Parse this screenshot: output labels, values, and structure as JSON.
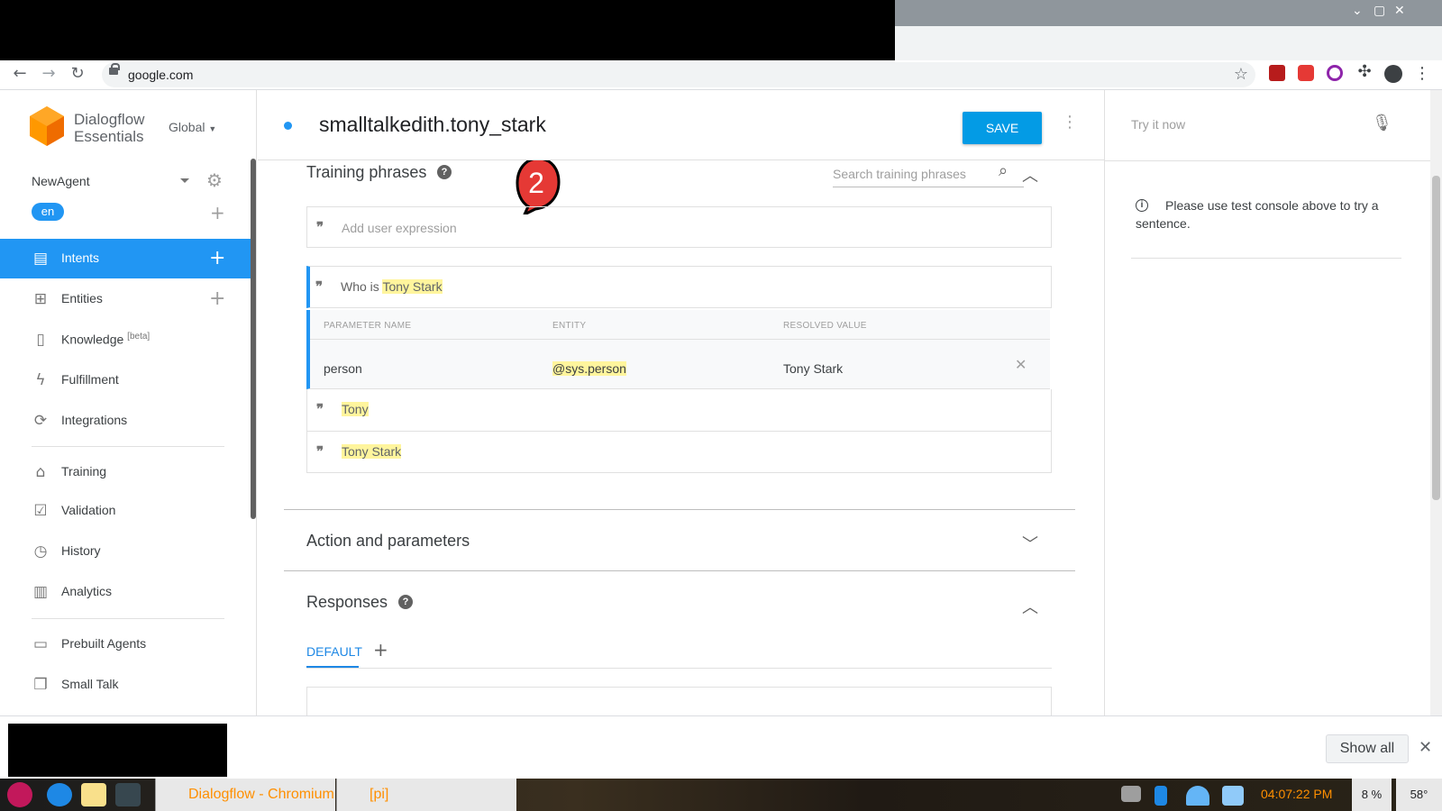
{
  "browser": {
    "url": "google.com",
    "window_controls": [
      "⌄",
      "▢",
      "✕"
    ]
  },
  "sidebar": {
    "brand_line1": "Dialogflow",
    "brand_line2": "Essentials",
    "region": "Global",
    "agent_name": "NewAgent",
    "language": "en",
    "items": [
      {
        "label": "Intents",
        "icon": "chat-icon"
      },
      {
        "label": "Entities",
        "icon": "sitemap-icon"
      },
      {
        "label": "Knowledge",
        "sup": "[beta]",
        "icon": "book-icon"
      },
      {
        "label": "Fulfillment",
        "icon": "bolt-icon"
      },
      {
        "label": "Integrations",
        "icon": "sync-icon"
      },
      {
        "label": "Training",
        "icon": "graduation-cap-icon"
      },
      {
        "label": "Validation",
        "icon": "checkbox-icon"
      },
      {
        "label": "History",
        "icon": "clock-icon"
      },
      {
        "label": "Analytics",
        "icon": "bar-chart-icon"
      },
      {
        "label": "Prebuilt Agents",
        "icon": "bookmark-icon"
      },
      {
        "label": "Small Talk",
        "icon": "chat-bubbles-icon"
      }
    ]
  },
  "header": {
    "intent_name": "smalltalkedith.tony_stark",
    "save_label": "SAVE"
  },
  "training": {
    "title": "Training phrases",
    "search_placeholder": "Search training phrases",
    "input_placeholder": "Add user expression",
    "annotation_number": "2",
    "phrases": [
      {
        "prefix": "Who is ",
        "highlight": "Tony Stark"
      },
      {
        "prefix": "",
        "highlight": "Tony"
      },
      {
        "prefix": "",
        "highlight": "Tony Stark"
      }
    ],
    "param_headers": [
      "PARAMETER NAME",
      "ENTITY",
      "RESOLVED VALUE"
    ],
    "param_row": {
      "name": "person",
      "entity": "@sys.person",
      "value": "Tony Stark"
    }
  },
  "action": {
    "title": "Action and parameters"
  },
  "responses": {
    "title": "Responses",
    "tab_default": "DEFAULT"
  },
  "console": {
    "try_placeholder": "Try it now",
    "info_text": "Please use test console above to try a sentence."
  },
  "downloads": {
    "show_all": "Show all"
  },
  "taskbar": {
    "chromium_task": "Dialogflow - Chromium",
    "folder_task": "[pi]",
    "time": "04:07:22 PM",
    "cpu": "8 %",
    "temp": "58°"
  },
  "colors": {
    "accent": "#2196f3",
    "save": "#039be5",
    "highlight": "#fff59d",
    "logo": "#ff9800"
  }
}
